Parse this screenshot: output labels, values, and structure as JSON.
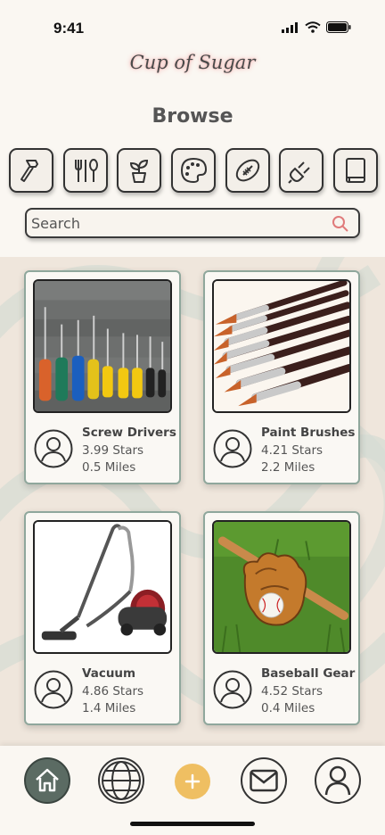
{
  "status_bar": {
    "time": "9:41"
  },
  "app": {
    "brand": "Cup of Sugar",
    "page_title": "Browse"
  },
  "categories": [
    {
      "icon": "hammer-icon"
    },
    {
      "icon": "utensils-icon"
    },
    {
      "icon": "plant-icon"
    },
    {
      "icon": "palette-icon"
    },
    {
      "icon": "football-icon"
    },
    {
      "icon": "plug-icon"
    },
    {
      "icon": "book-icon"
    }
  ],
  "search": {
    "placeholder": "Search",
    "value": ""
  },
  "items": [
    {
      "name": "Screw Drivers",
      "stars": "3.99 Stars",
      "distance": "0.5 Miles",
      "image": "screwdrivers"
    },
    {
      "name": "Paint Brushes",
      "stars": "4.21 Stars",
      "distance": "2.2 Miles",
      "image": "paint-brushes"
    },
    {
      "name": "Vacuum",
      "stars": "4.86 Stars",
      "distance": "1.4 Miles",
      "image": "vacuum"
    },
    {
      "name": "Baseball Gear",
      "stars": "4.52 Stars",
      "distance": "0.4 Miles",
      "image": "baseball-gear"
    }
  ],
  "nav": [
    "home-icon",
    "globe-icon",
    "plus-icon",
    "mail-icon",
    "profile-icon"
  ],
  "colors": {
    "accent": "#efbf62",
    "card_border": "#8fa79c",
    "home_active": "#5b6b63",
    "search_icon": "#e07a7a"
  }
}
